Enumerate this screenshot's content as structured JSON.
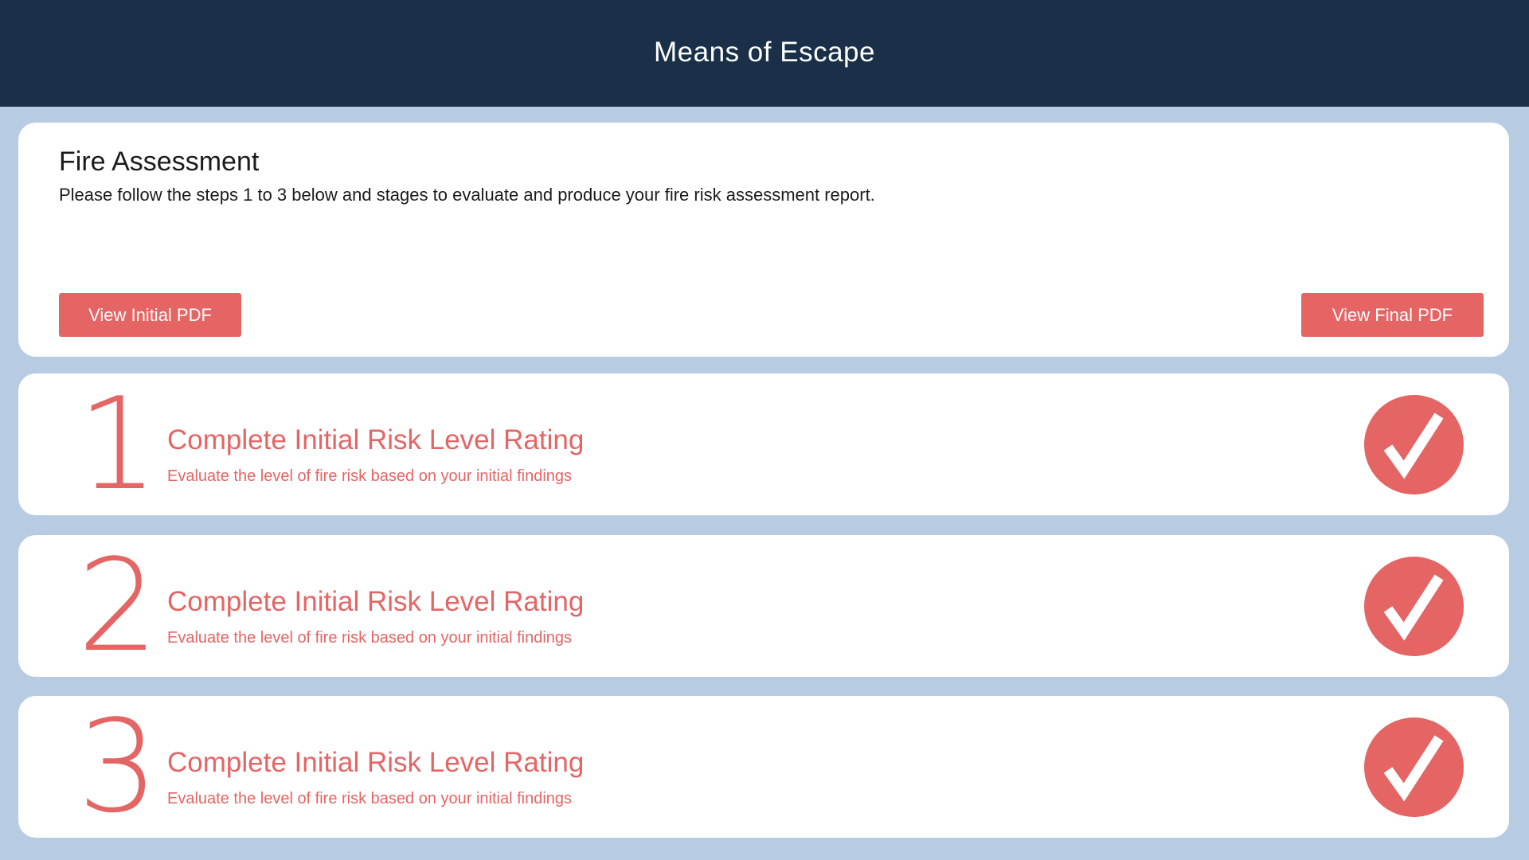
{
  "header": {
    "title": "Means of Escape"
  },
  "intro": {
    "title": "Fire Assessment",
    "description": "Please follow the steps 1 to 3 below and stages to evaluate and produce your fire risk assessment report.",
    "view_initial_label": "View Initial PDF",
    "view_final_label": "View Final PDF"
  },
  "steps": [
    {
      "number": "1",
      "title": "Complete Initial Risk Level Rating",
      "description": "Evaluate the level of fire risk based on your initial findings",
      "status_icon": "checkmark-circle-icon"
    },
    {
      "number": "2",
      "title": "Complete Initial Risk Level Rating",
      "description": "Evaluate the level of fire risk based on your initial findings",
      "status_icon": "checkmark-circle-icon"
    },
    {
      "number": "3",
      "title": "Complete Initial Risk Level Rating",
      "description": "Evaluate the level of fire risk based on your initial findings",
      "status_icon": "checkmark-circle-icon"
    }
  ],
  "colors": {
    "header_bg": "#1a2f48",
    "page_bg": "#b7cce3",
    "accent": "#e56464",
    "card_bg": "#ffffff"
  }
}
